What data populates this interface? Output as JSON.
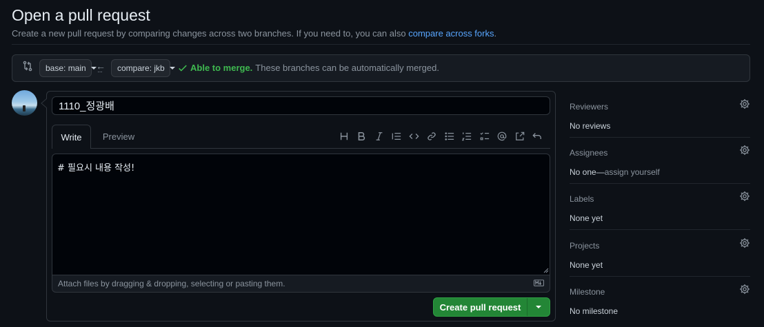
{
  "page": {
    "title": "Open a pull request",
    "subtitle_prefix": "Create a new pull request by comparing changes across two branches. If you need to, you can also ",
    "subtitle_link": "compare across forks",
    "subtitle_suffix": "."
  },
  "range": {
    "base_label": "base: main",
    "compare_label": "compare: jkb",
    "merge_status": "Able to merge.",
    "merge_detail": "These branches can be automatically merged."
  },
  "editor": {
    "title_value": "1110_정광배",
    "tab_write": "Write",
    "tab_preview": "Preview",
    "body_value": "# 필요시 내용 작성!",
    "attach_hint": "Attach files by dragging & dropping, selecting or pasting them.",
    "toolbar_icons": [
      "heading-icon",
      "bold-icon",
      "italic-icon",
      "quote-icon",
      "code-icon",
      "link-icon",
      "bulleted-list-icon",
      "numbered-list-icon",
      "task-list-icon",
      "mention-icon",
      "reference-icon",
      "reply-icon"
    ]
  },
  "actions": {
    "create_label": "Create pull request"
  },
  "sidebar": {
    "reviewers": {
      "heading": "Reviewers",
      "value": "No reviews"
    },
    "assignees": {
      "heading": "Assignees",
      "value_prefix": "No one—",
      "value_link": "assign yourself"
    },
    "labels": {
      "heading": "Labels",
      "value": "None yet"
    },
    "projects": {
      "heading": "Projects",
      "value": "None yet"
    },
    "milestone": {
      "heading": "Milestone",
      "value": "No milestone"
    }
  },
  "colors": {
    "background": "#0d1117",
    "accent_link": "#58a6ff",
    "success": "#3fb950",
    "primary_button": "#238636"
  }
}
